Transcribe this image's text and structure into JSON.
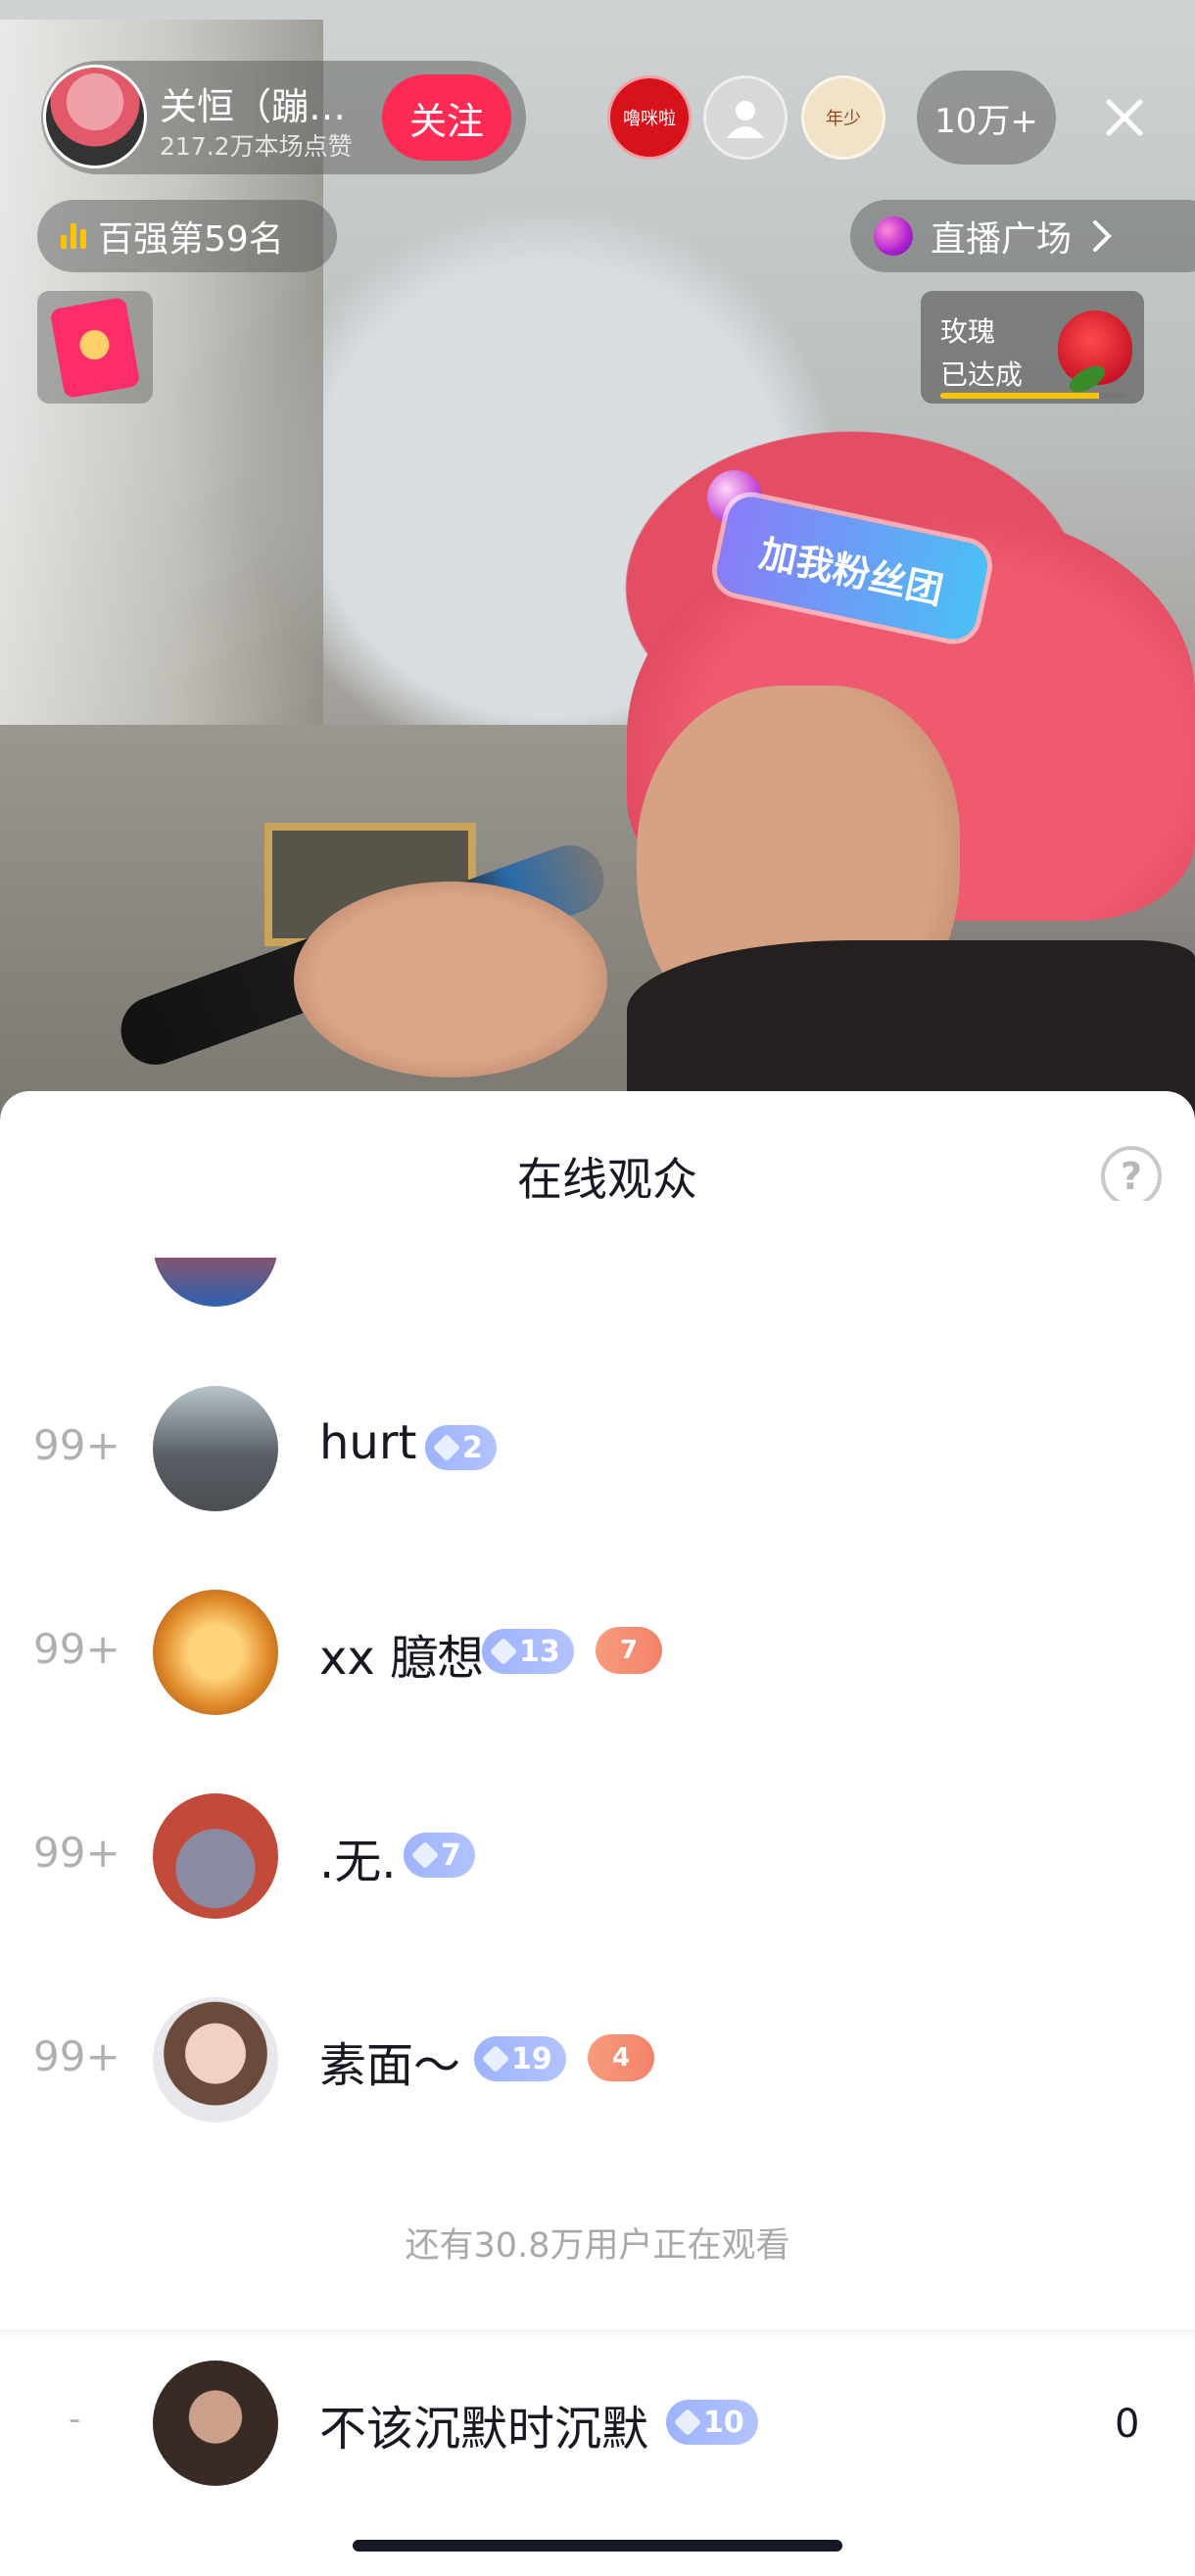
{
  "host": {
    "name": "关恒（蹦…",
    "likes": "217.2万本场点赞",
    "follow_label": "关注"
  },
  "top_viewers": [
    "嚕咪啦",
    "",
    "年少"
  ],
  "viewer_count": "10万+",
  "rank_label": "百强第59名",
  "plaza_label": "直播广场",
  "rose": {
    "line1": "玫瑰",
    "line2": "已达成",
    "progress": 0.85
  },
  "fan_sticker": "加我粉丝团",
  "sheet": {
    "title": "在线观众",
    "help": "?"
  },
  "viewers": [
    {
      "rank": "99+",
      "name": "hurt",
      "level": "2",
      "heart": ""
    },
    {
      "rank": "99+",
      "name": "xx 臆想",
      "level": "13",
      "heart": "7"
    },
    {
      "rank": "99+",
      "name": ".无.",
      "level": "7",
      "heart": ""
    },
    {
      "rank": "99+",
      "name": "素面～",
      "level": "19",
      "heart": "4"
    }
  ],
  "watching_more": "还有30.8万用户正在观看",
  "me": {
    "rank": "-",
    "name": "不该沉默时沉默",
    "level": "10",
    "score": "0"
  },
  "colors": {
    "accent": "#fe2c55",
    "badge": "#9db3ff",
    "heart": "#f2826a"
  }
}
